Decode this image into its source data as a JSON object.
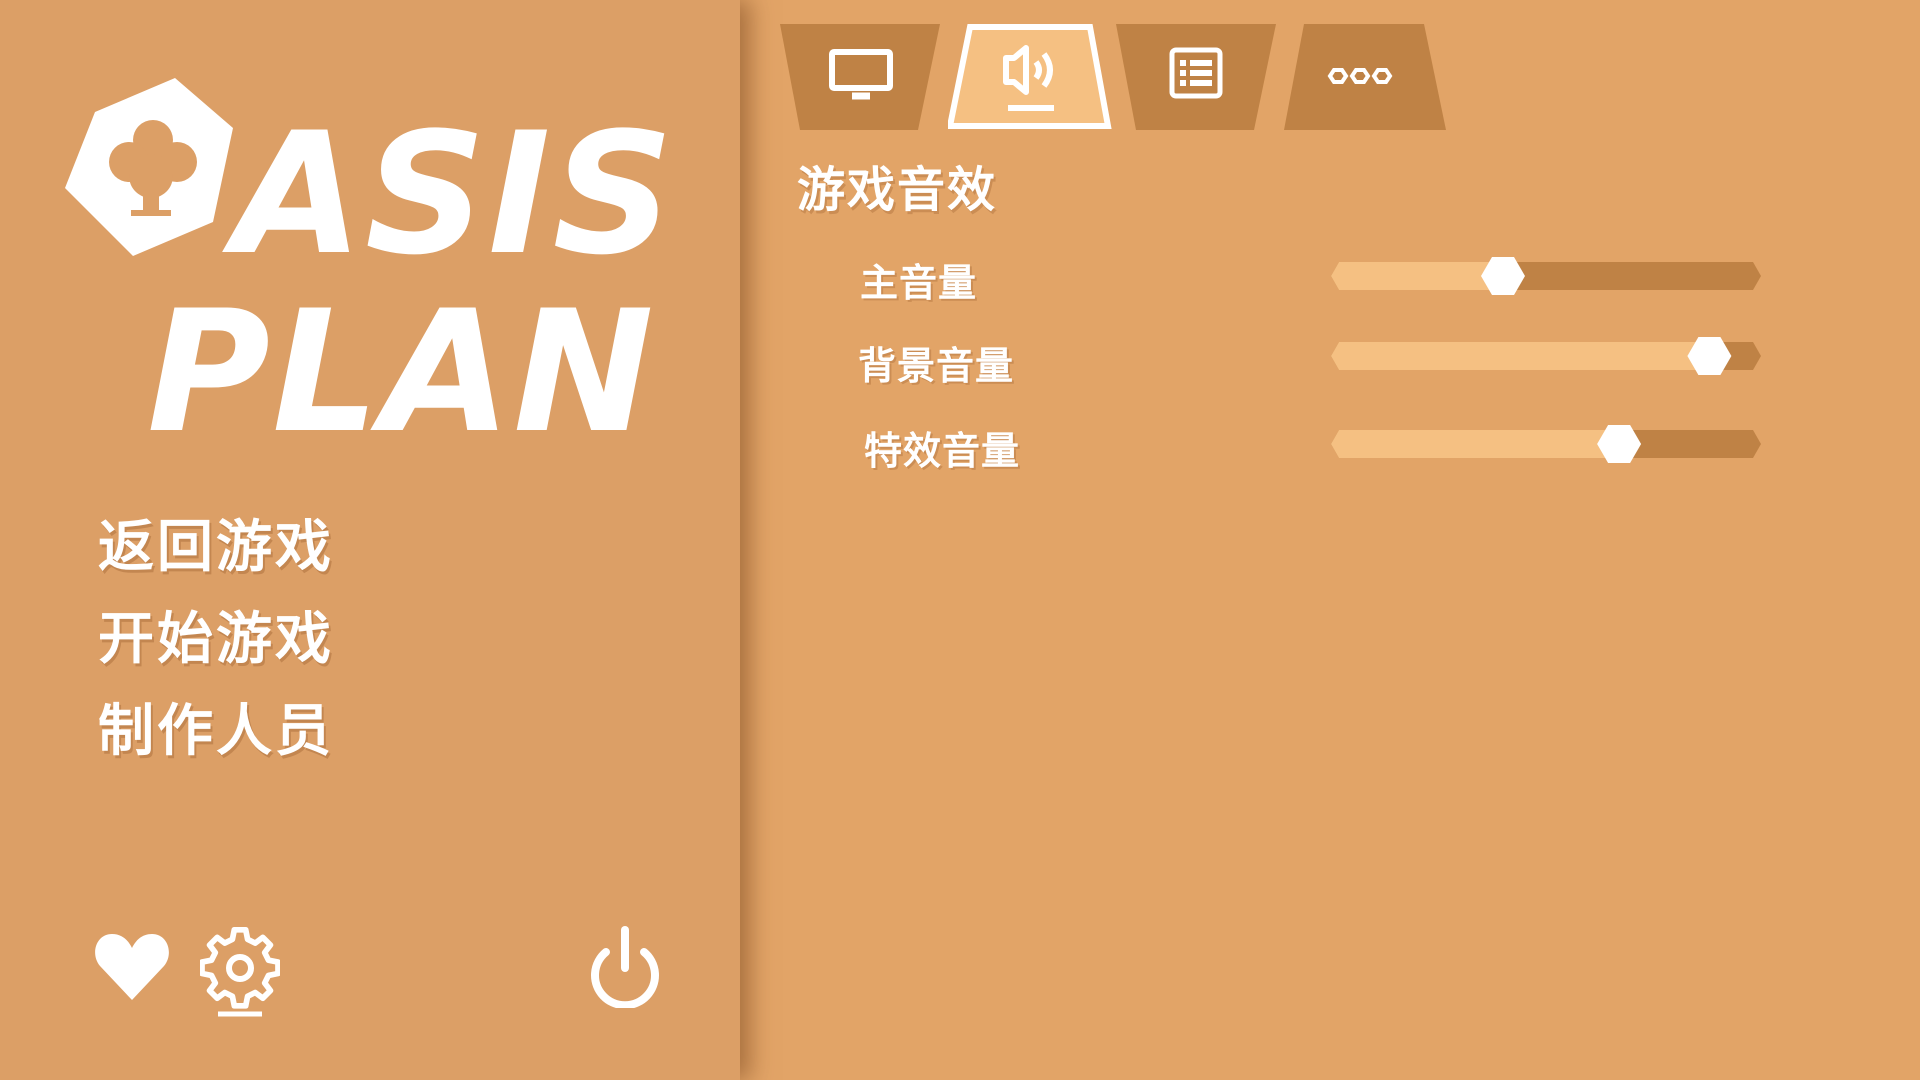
{
  "logo": {
    "line1": "ASIS",
    "line2": "PLAN",
    "emblem": "tree-hexagon-icon"
  },
  "menu": {
    "items": [
      {
        "label": "返回游戏"
      },
      {
        "label": "开始游戏"
      },
      {
        "label": "制作人员"
      }
    ]
  },
  "bottom_icons": {
    "favorite": "heart-icon",
    "settings": "gear-icon",
    "power": "power-icon"
  },
  "tabs": [
    {
      "icon": "monitor-icon",
      "active": false
    },
    {
      "icon": "speaker-icon",
      "active": true
    },
    {
      "icon": "list-icon",
      "active": false
    },
    {
      "icon": "more-icon",
      "active": false
    }
  ],
  "audio": {
    "title": "游戏音效",
    "sliders": [
      {
        "label": "主音量",
        "value": 0.4
      },
      {
        "label": "背景音量",
        "value": 0.88
      },
      {
        "label": "特效音量",
        "value": 0.67
      }
    ]
  },
  "colors": {
    "left_panel": "#dc9f66",
    "right_panel": "#e2a467",
    "tab": "#bf8245",
    "tab_active": "#f5c082",
    "track_filled": "#f5c082",
    "track_empty": "#bf8245",
    "text": "#ffffff"
  }
}
